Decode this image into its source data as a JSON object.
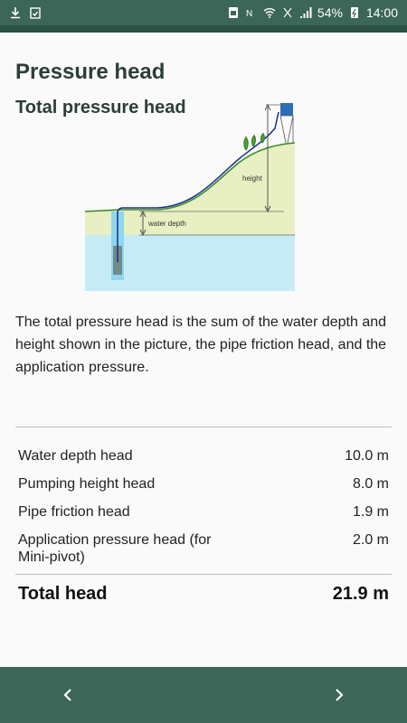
{
  "status_bar": {
    "battery": "54%",
    "time": "14:00",
    "icons": [
      "download-icon",
      "clipboard-check-icon",
      "alarm-icon",
      "nfc-icon",
      "wifi-icon",
      "mute-icon",
      "signal-icon",
      "battery-icon"
    ]
  },
  "page": {
    "title": "Pressure head",
    "subtitle": "Total pressure head"
  },
  "diagram": {
    "height_label": "height",
    "water_depth_label": "water depth",
    "colors": {
      "ground": "#e8efc2",
      "water": "#c6ebf7",
      "pipe": "#1a2f8c",
      "grass": "#3a8a2a"
    }
  },
  "description": "The total pressure head is the sum of the water depth and height shown in the picture, the pipe friction head, and the application pressure.",
  "heads": [
    {
      "label": "Water depth head",
      "value": "10.0 m"
    },
    {
      "label": "Pumping height head",
      "value": "8.0 m"
    },
    {
      "label": "Pipe friction head",
      "value": "1.9 m"
    },
    {
      "label": "Application pressure head (for Mini-pivot)",
      "value": "2.0 m"
    }
  ],
  "total": {
    "label": "Total head",
    "value": "21.9 m"
  },
  "nav": {
    "prev_icon": "chevron-left-icon",
    "next_icon": "chevron-right-icon"
  },
  "theme": {
    "primary": "#3b6658",
    "primary_dark": "#2c4f43"
  }
}
